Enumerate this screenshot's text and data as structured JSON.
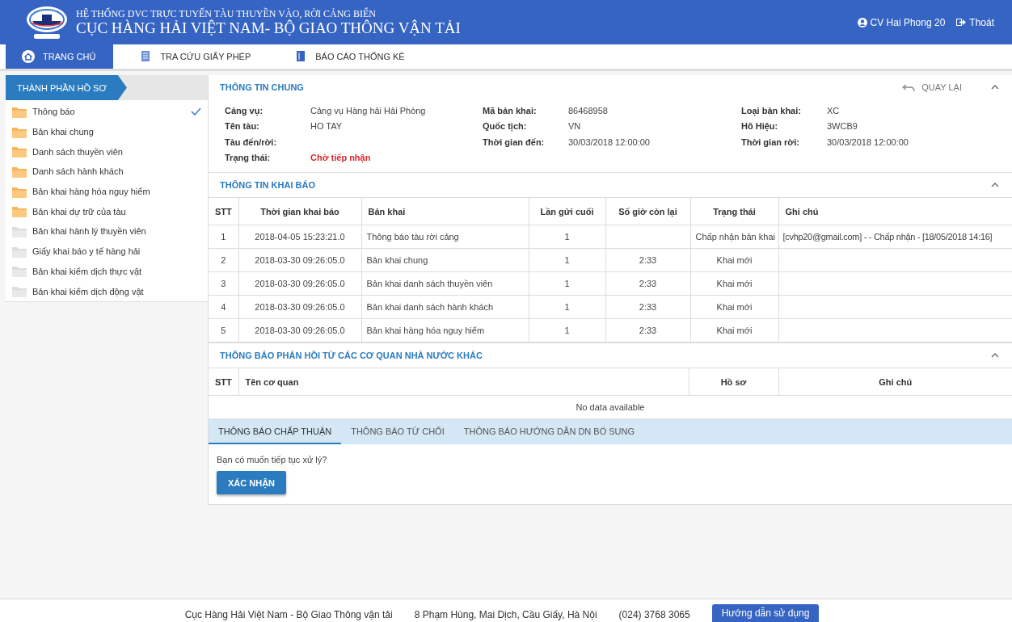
{
  "header": {
    "subtitle": "HỆ THỐNG DVC TRỰC TUYẾN TÀU THUYỀN VÀO, RỜI CẢNG BIỂN",
    "title": "CỤC HÀNG HẢI VIỆT NAM- BỘ GIAO THÔNG VẬN TẢI",
    "user": "CV Hai Phong 20",
    "logout": "Thoát"
  },
  "nav": [
    {
      "label": "TRANG CHỦ",
      "selected": true
    },
    {
      "label": "TRA CỨU GIẤY PHÉP",
      "selected": false
    },
    {
      "label": "BÁO CÁO THỐNG KÊ",
      "selected": false
    }
  ],
  "sidebar": {
    "title": "THÀNH PHẦN HỒ SƠ",
    "items": [
      {
        "label": "Thông báo",
        "filled": true,
        "checked": true
      },
      {
        "label": "Bản khai chung",
        "filled": true,
        "checked": false
      },
      {
        "label": "Danh sách thuyền viên",
        "filled": true,
        "checked": false
      },
      {
        "label": "Danh sách hành khách",
        "filled": true,
        "checked": false
      },
      {
        "label": "Bản khai hàng hóa nguy hiểm",
        "filled": true,
        "checked": false
      },
      {
        "label": "Bản khai dự trữ của tàu",
        "filled": true,
        "checked": false
      },
      {
        "label": "Bản khai hành lý thuyền viên",
        "filled": false,
        "checked": false
      },
      {
        "label": "Giấy khai báo y tế hàng hải",
        "filled": false,
        "checked": false
      },
      {
        "label": "Bản khai kiểm dịch thực vật",
        "filled": false,
        "checked": false
      },
      {
        "label": "Bản khai kiểm dịch động vật",
        "filled": false,
        "checked": false
      }
    ]
  },
  "general_info": {
    "title": "THÔNG TIN CHUNG",
    "back": "QUAY LẠI",
    "columns": [
      [
        {
          "label": "Cảng vụ:",
          "value": "Cảng vụ Hàng hải Hải Phòng",
          "kind": "plain"
        },
        {
          "label": "Tên tàu:",
          "value": "HO TAY",
          "kind": "plain"
        },
        {
          "label": "Tàu đến/rời:",
          "kind": "plain"
        },
        {
          "label": "Trạng thái:",
          "value": "Chờ tiếp nhận",
          "kind": "status"
        }
      ],
      [
        {
          "label": "Mã bản khai:",
          "value": "86468958",
          "kind": "plain"
        },
        {
          "label": "Quốc tịch:",
          "value": "VN",
          "kind": "plain"
        },
        {
          "label": "Thời gian đến:",
          "value": "30/03/2018 12:00:00",
          "kind": "plain"
        }
      ],
      [
        {
          "label": "Loại bản khai:",
          "value": "XC",
          "kind": "plain"
        },
        {
          "label": "Hô Hiệu:",
          "value": "3WCB9",
          "kind": "plain"
        },
        {
          "label": "Thời gian rời:",
          "value": "30/03/2018 12:00:00",
          "kind": "plain"
        }
      ]
    ]
  },
  "declarations": {
    "title": "THÔNG TIN KHAI BÁO",
    "columns": [
      "STT",
      "Thời gian khai báo",
      "Bản khai",
      "Lần gửi cuối",
      "Số giờ còn lại",
      "Trạng thái",
      "Ghi chú"
    ],
    "rows": [
      {
        "stt": "1",
        "time": "2018-04-05 15:23:21.0",
        "form": "Thông báo tàu rời cảng",
        "sends": "1",
        "status": "Chấp nhận bản khai",
        "note": "[cvhp20@gmail.com] - - Chấp nhận - [18/05/2018 14:16]"
      },
      {
        "stt": "2",
        "time": "2018-03-30 09:26:05.0",
        "form": "Bản khai chung",
        "sends": "1",
        "hours": "2:33",
        "status": "Khai mới"
      },
      {
        "stt": "3",
        "time": "2018-03-30 09:26:05.0",
        "form": "Bản khai danh sách thuyền viên",
        "sends": "1",
        "hours": "2:33",
        "status": "Khai mới"
      },
      {
        "stt": "4",
        "time": "2018-03-30 09:26:05.0",
        "form": "Bản khai danh sách hành khách",
        "sends": "1",
        "hours": "2:33",
        "status": "Khai mới"
      },
      {
        "stt": "5",
        "time": "2018-03-30 09:26:05.0",
        "form": "Bản khai hàng hóa nguy hiểm",
        "sends": "1",
        "hours": "2:33",
        "status": "Khai mới"
      }
    ]
  },
  "feedback": {
    "title": "THÔNG BÁO PHẢN HỒI TỪ CÁC CƠ QUAN NHÀ NƯỚC KHÁC",
    "columns": [
      "STT",
      "Tên cơ quan",
      "Hồ sơ",
      "Ghi chú"
    ],
    "empty_text": "No data available"
  },
  "tabs": [
    {
      "label": "THÔNG BÁO CHẤP THUẬN",
      "selected": true
    },
    {
      "label": "THÔNG BÁO TỪ CHỐI",
      "selected": false
    },
    {
      "label": "THÔNG BÁO HƯỚNG DẪN DN BỔ SUNG",
      "selected": false
    }
  ],
  "prompt": "Bạn có muốn tiếp tục xử lý?",
  "confirm_button": "XÁC NHẬN",
  "footer": {
    "org": "Cục Hàng Hải Việt Nam - Bộ Giao Thông vận tải",
    "address": "8 Phạm Hùng, Mai Dịch, Cầu Giấy, Hà Nội",
    "phone": "(024) 3768 3065",
    "help_button": "Hướng dẫn sử dụng"
  }
}
